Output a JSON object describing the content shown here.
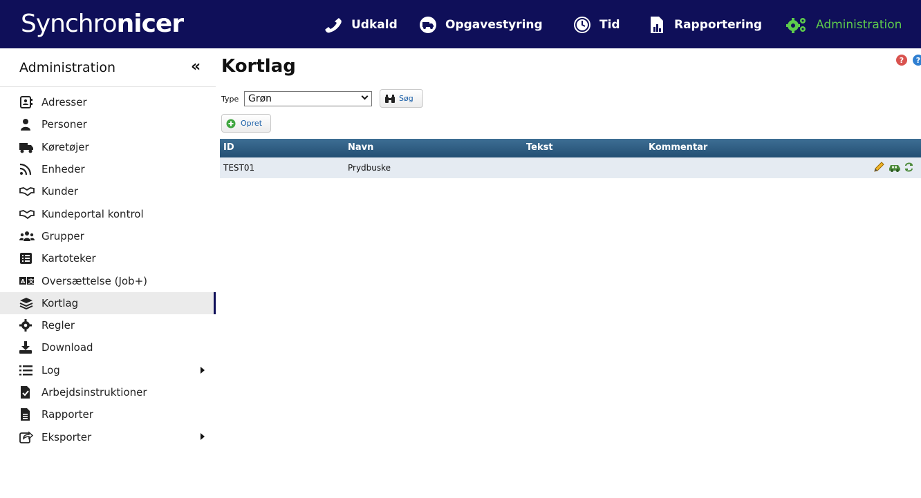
{
  "app": {
    "logo_regular": "Synchro",
    "logo_bold": "nicer"
  },
  "topnav": [
    {
      "label": "Udkald",
      "icon": "phone-icon"
    },
    {
      "label": "Opgavestyring",
      "icon": "truck-circle-icon"
    },
    {
      "label": "Tid",
      "icon": "clock-icon"
    },
    {
      "label": "Rapportering",
      "icon": "report-chart-icon"
    },
    {
      "label": "Administration",
      "icon": "gears-icon",
      "active": true
    }
  ],
  "sidebar": {
    "title": "Administration",
    "collapse_label": "«",
    "items": [
      {
        "label": "Adresser",
        "icon": "address-book-icon"
      },
      {
        "label": "Personer",
        "icon": "person-icon"
      },
      {
        "label": "Køretøjer",
        "icon": "truck-icon"
      },
      {
        "label": "Enheder",
        "icon": "rss-icon"
      },
      {
        "label": "Kunder",
        "icon": "handshake-icon"
      },
      {
        "label": "Kundeportal kontrol",
        "icon": "handshake-icon"
      },
      {
        "label": "Grupper",
        "icon": "users-icon"
      },
      {
        "label": "Kartoteker",
        "icon": "list-table-icon"
      },
      {
        "label": "Oversættelse (Job+)",
        "icon": "translate-icon"
      },
      {
        "label": "Kortlag",
        "icon": "layers-icon",
        "active": true
      },
      {
        "label": "Regler",
        "icon": "cog-icon"
      },
      {
        "label": "Download",
        "icon": "download-icon"
      },
      {
        "label": "Log",
        "icon": "list-icon",
        "submenu": true
      },
      {
        "label": "Arbejdsinstruktioner",
        "icon": "file-check-icon"
      },
      {
        "label": "Rapporter",
        "icon": "file-text-icon"
      },
      {
        "label": "Eksporter",
        "icon": "share-icon",
        "submenu": true
      }
    ]
  },
  "main": {
    "title": "Kortlag",
    "filter": {
      "type_label": "Type",
      "type_value": "Grøn",
      "search_label": "Søg"
    },
    "create_label": "Opret",
    "table": {
      "columns": [
        "ID",
        "Navn",
        "Tekst",
        "Kommentar"
      ],
      "rows": [
        {
          "id": "TEST01",
          "navn": "Prydbuske",
          "tekst": "",
          "kommentar": ""
        }
      ]
    }
  },
  "colors": {
    "topbar": "#0f0f59",
    "active_nav": "#5dcb4c",
    "table_header": "#2f5e84",
    "row_bg": "#e5ebf2"
  }
}
